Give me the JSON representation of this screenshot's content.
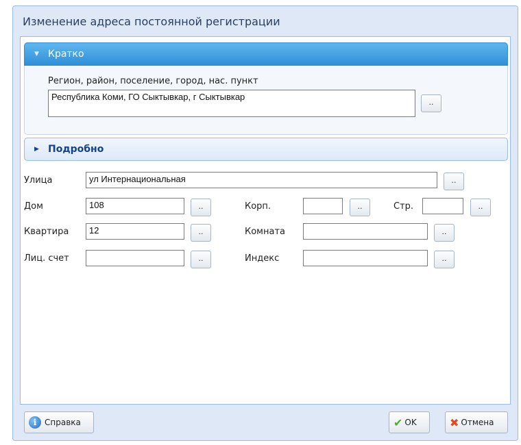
{
  "window": {
    "title": "Изменение адреса постоянной регистрации"
  },
  "panel_short": {
    "header": "Кратко",
    "region_label": "Регион, район, поселение, город, нас. пункт",
    "region_value": "Республика Коми, ГО Сыктывкар, г Сыктывкар"
  },
  "panel_detail": {
    "header": "Подробно"
  },
  "fields": {
    "street_label": "Улица",
    "street_value": "ул Интернациональная",
    "house_label": "Дом",
    "house_value": "108",
    "building_label": "Корп.",
    "building_value": "",
    "structure_label": "Стр.",
    "structure_value": "",
    "apartment_label": "Квартира",
    "apartment_value": "12",
    "room_label": "Комната",
    "room_value": "",
    "account_label": "Лиц. счет",
    "account_value": "",
    "index_label": "Индекс",
    "index_value": ""
  },
  "dots_label": "..",
  "footer": {
    "help_label": "Справка",
    "ok_label": "OK",
    "cancel_label": "Отмена"
  },
  "icons": {
    "short_expand": "triangle-down-icon",
    "detail_expand": "triangle-right-icon",
    "help": "info-icon",
    "ok": "check-icon",
    "cancel": "cross-icon"
  },
  "colors": {
    "accent_header": "#2f8fd8",
    "window_bg": "#dfe8f6",
    "detail_header_text": "#15428b"
  }
}
